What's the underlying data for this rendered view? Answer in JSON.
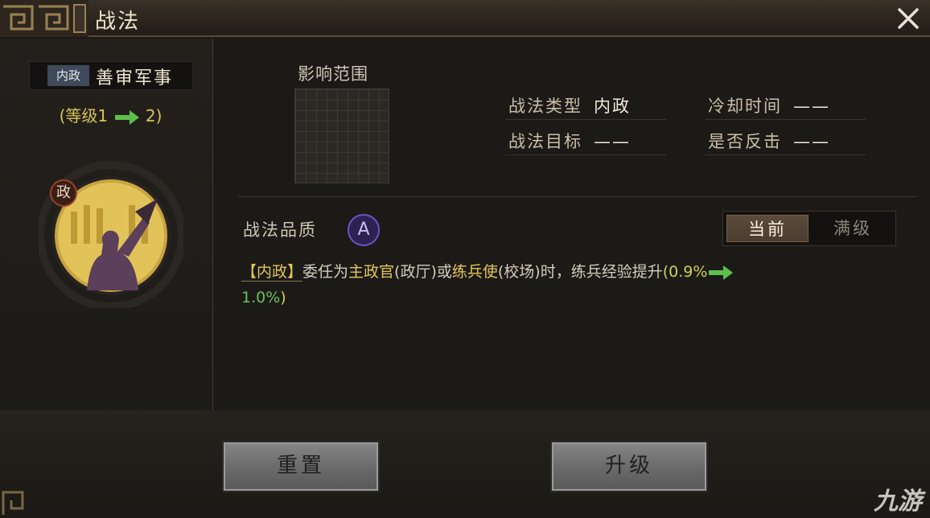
{
  "window": {
    "title": "战法"
  },
  "skill": {
    "type_tag": "内政",
    "name": "善审军事",
    "level_prefix": "(等级1",
    "level_suffix": "2)",
    "portrait_badge": "政"
  },
  "info": {
    "range_label": "影响范围",
    "type_label": "战法类型",
    "type_value": "内政",
    "cooldown_label": "冷却时间",
    "cooldown_value": "——",
    "target_label": "战法目标",
    "target_value": "——",
    "counter_label": "是否反击",
    "counter_value": "——"
  },
  "quality": {
    "label": "战法品质",
    "grade": "A",
    "toggle_current": "当前",
    "toggle_max": "满级"
  },
  "description": {
    "tag": "【内政】",
    "part1": "委任为",
    "hl1": "主政官",
    "part2": "(政厅)或",
    "hl2": "练兵使",
    "part3": "(校场)时，练兵经验提升",
    "val_open": "(0.9%",
    "val_new": "1.0%",
    "val_close": ")"
  },
  "buttons": {
    "reset": "重置",
    "upgrade": "升级"
  },
  "watermark": "九游",
  "colors": {
    "accent_gold": "#e3c659",
    "accent_green": "#66c15a",
    "quality_purple": "#6f52c9"
  }
}
